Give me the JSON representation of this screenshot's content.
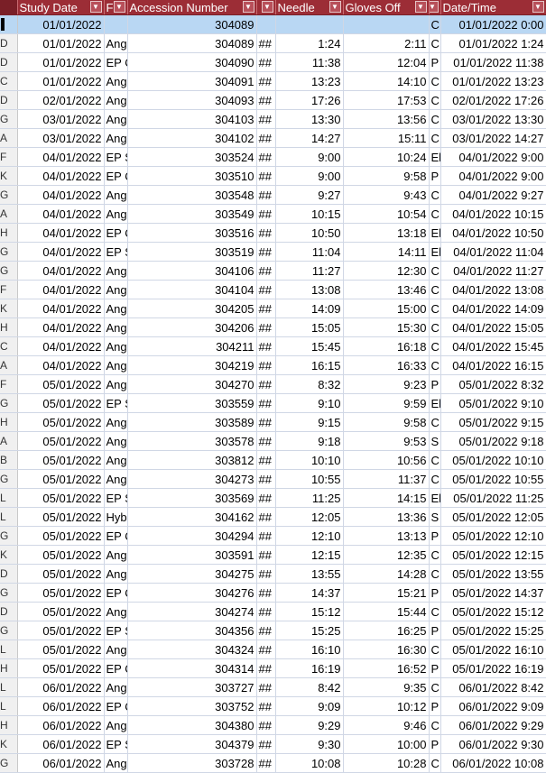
{
  "columns": [
    {
      "key": "selector",
      "label": ""
    },
    {
      "key": "study_date",
      "label": "Study Date"
    },
    {
      "key": "f",
      "label": "F"
    },
    {
      "key": "accession",
      "label": "Accession Number"
    },
    {
      "key": "hash",
      "label": ""
    },
    {
      "key": "needle",
      "label": "Needle"
    },
    {
      "key": "gloves_off",
      "label": "Gloves Off"
    },
    {
      "key": "g",
      "label": ""
    },
    {
      "key": "date_time",
      "label": "Date/Time"
    }
  ],
  "rows": [
    [
      "",
      "01/01/2022",
      "",
      "304089",
      "",
      "",
      "",
      "C",
      "01/01/2022 0:00"
    ],
    [
      "D",
      "01/01/2022",
      "Ang",
      "304089",
      "##",
      "1:24",
      "2:11",
      "C",
      "01/01/2022 1:24"
    ],
    [
      "D",
      "01/01/2022",
      "EP C",
      "304090",
      "##",
      "11:38",
      "12:04",
      "P",
      "01/01/2022 11:38"
    ],
    [
      "C",
      "01/01/2022",
      "Ang",
      "304091",
      "##",
      "13:23",
      "14:10",
      "C",
      "01/01/2022 13:23"
    ],
    [
      "D",
      "02/01/2022",
      "Ang",
      "304093",
      "##",
      "17:26",
      "17:53",
      "C",
      "02/01/2022 17:26"
    ],
    [
      "G",
      "03/01/2022",
      "Ang",
      "304103",
      "##",
      "13:30",
      "13:56",
      "C",
      "03/01/2022 13:30"
    ],
    [
      "A",
      "03/01/2022",
      "Ang",
      "304102",
      "##",
      "14:27",
      "15:11",
      "C",
      "03/01/2022 14:27"
    ],
    [
      "F",
      "04/01/2022",
      "EP S",
      "303524",
      "##",
      "9:00",
      "10:24",
      "El",
      "04/01/2022 9:00"
    ],
    [
      "K",
      "04/01/2022",
      "EP C",
      "303510",
      "##",
      "9:00",
      "9:58",
      "P",
      "04/01/2022 9:00"
    ],
    [
      "G",
      "04/01/2022",
      "Ang",
      "303548",
      "##",
      "9:27",
      "9:43",
      "C",
      "04/01/2022 9:27"
    ],
    [
      "A",
      "04/01/2022",
      "Ang",
      "303549",
      "##",
      "10:15",
      "10:54",
      "C",
      "04/01/2022 10:15"
    ],
    [
      "H",
      "04/01/2022",
      "EP C",
      "303516",
      "##",
      "10:50",
      "13:18",
      "El",
      "04/01/2022 10:50"
    ],
    [
      "G",
      "04/01/2022",
      "EP S",
      "303519",
      "##",
      "11:04",
      "14:11",
      "El",
      "04/01/2022 11:04"
    ],
    [
      "G",
      "04/01/2022",
      "Ang",
      "304106",
      "##",
      "11:27",
      "12:30",
      "C",
      "04/01/2022 11:27"
    ],
    [
      "F",
      "04/01/2022",
      "Ang",
      "304104",
      "##",
      "13:08",
      "13:46",
      "C",
      "04/01/2022 13:08"
    ],
    [
      "K",
      "04/01/2022",
      "Ang",
      "304205",
      "##",
      "14:09",
      "15:00",
      "C",
      "04/01/2022 14:09"
    ],
    [
      "H",
      "04/01/2022",
      "Ang",
      "304206",
      "##",
      "15:05",
      "15:30",
      "C",
      "04/01/2022 15:05"
    ],
    [
      "C",
      "04/01/2022",
      "Ang",
      "304211",
      "##",
      "15:45",
      "16:18",
      "C",
      "04/01/2022 15:45"
    ],
    [
      "A",
      "04/01/2022",
      "Ang",
      "304219",
      "##",
      "16:15",
      "16:33",
      "C",
      "04/01/2022 16:15"
    ],
    [
      "F",
      "05/01/2022",
      "Ang",
      "304270",
      "##",
      "8:32",
      "9:23",
      "P",
      "05/01/2022 8:32"
    ],
    [
      "G",
      "05/01/2022",
      "EP S",
      "303559",
      "##",
      "9:10",
      "9:59",
      "El",
      "05/01/2022 9:10"
    ],
    [
      "H",
      "05/01/2022",
      "Ang",
      "303589",
      "##",
      "9:15",
      "9:58",
      "C",
      "05/01/2022 9:15"
    ],
    [
      "A",
      "05/01/2022",
      "Ang",
      "303578",
      "##",
      "9:18",
      "9:53",
      "S",
      "05/01/2022 9:18"
    ],
    [
      "B",
      "05/01/2022",
      "Ang",
      "303812",
      "##",
      "10:10",
      "10:56",
      "C",
      "05/01/2022 10:10"
    ],
    [
      "G",
      "05/01/2022",
      "Ang",
      "304273",
      "##",
      "10:55",
      "11:37",
      "C",
      "05/01/2022 10:55"
    ],
    [
      "L",
      "05/01/2022",
      "EP S",
      "303569",
      "##",
      "11:25",
      "14:15",
      "El",
      "05/01/2022 11:25"
    ],
    [
      "L",
      "05/01/2022",
      "Hyb",
      "304162",
      "##",
      "12:05",
      "13:36",
      "S",
      "05/01/2022 12:05"
    ],
    [
      "G",
      "05/01/2022",
      "EP C",
      "304294",
      "##",
      "12:10",
      "13:13",
      "P",
      "05/01/2022 12:10"
    ],
    [
      "K",
      "05/01/2022",
      "Ang",
      "303591",
      "##",
      "12:15",
      "12:35",
      "C",
      "05/01/2022 12:15"
    ],
    [
      "D",
      "05/01/2022",
      "Ang",
      "304275",
      "##",
      "13:55",
      "14:28",
      "C",
      "05/01/2022 13:55"
    ],
    [
      "G",
      "05/01/2022",
      "EP C",
      "304276",
      "##",
      "14:37",
      "15:21",
      "P",
      "05/01/2022 14:37"
    ],
    [
      "D",
      "05/01/2022",
      "Ang",
      "304274",
      "##",
      "15:12",
      "15:44",
      "C",
      "05/01/2022 15:12"
    ],
    [
      "G",
      "05/01/2022",
      "EP S",
      "304356",
      "##",
      "15:25",
      "16:25",
      "P",
      "05/01/2022 15:25"
    ],
    [
      "L",
      "05/01/2022",
      "Ang",
      "304324",
      "##",
      "16:10",
      "16:30",
      "C",
      "05/01/2022 16:10"
    ],
    [
      "H",
      "05/01/2022",
      "EP C",
      "304314",
      "##",
      "16:19",
      "16:52",
      "P",
      "05/01/2022 16:19"
    ],
    [
      "L",
      "06/01/2022",
      "Ang",
      "303727",
      "##",
      "8:42",
      "9:35",
      "C",
      "06/01/2022 8:42"
    ],
    [
      "L",
      "06/01/2022",
      "EP C",
      "303752",
      "##",
      "9:09",
      "10:12",
      "P",
      "06/01/2022 9:09"
    ],
    [
      "H",
      "06/01/2022",
      "Ang",
      "304380",
      "##",
      "9:29",
      "9:46",
      "C",
      "06/01/2022 9:29"
    ],
    [
      "K",
      "06/01/2022",
      "EP S",
      "304379",
      "##",
      "9:30",
      "10:00",
      "P",
      "06/01/2022 9:30"
    ],
    [
      "G",
      "06/01/2022",
      "Ang",
      "303728",
      "##",
      "10:08",
      "10:28",
      "C",
      "06/01/2022 10:08"
    ]
  ],
  "colors": {
    "header_bg": "#9c2d36",
    "selected_row": "#b9d7f3",
    "gridline": "#d0d7e5"
  }
}
